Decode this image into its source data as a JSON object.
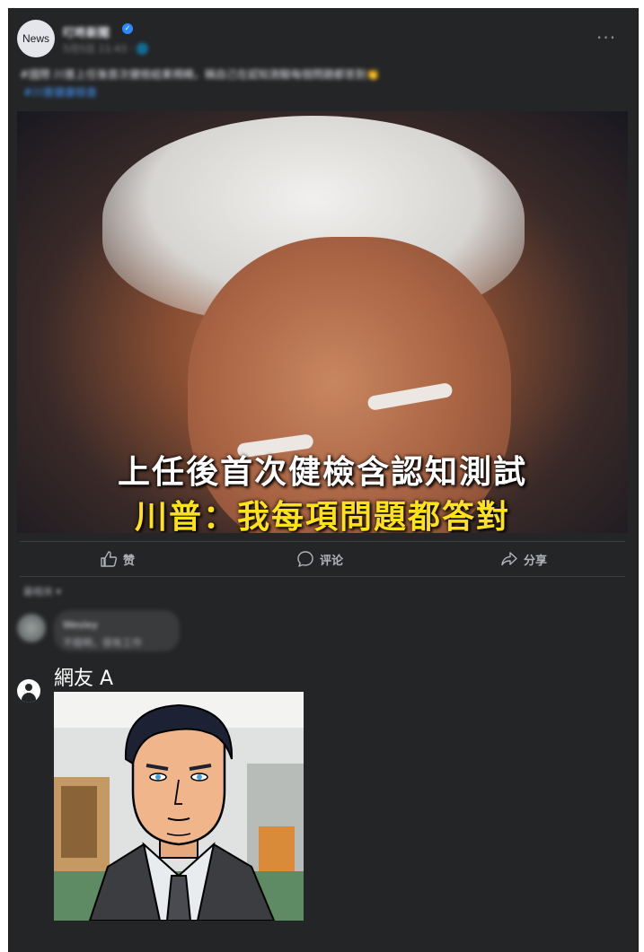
{
  "post": {
    "avatar_label": "News",
    "page_name": "叮咚新聞",
    "verified_glyph": "✓",
    "meta": "5月5日 11:43 · 🌐",
    "more_glyph": "···",
    "caption": "#國際 川普上任後首次健檢結果揭曉，稱自己在認知測驗每個問題都答對👏",
    "caption_link": "#川普健康檢查",
    "image": {
      "headline_line1": "上任後首次健檢含認知測試",
      "headline_line2": "川普：我每項問題都答對"
    }
  },
  "actions": {
    "like": "赞",
    "comment": "评论",
    "share": "分享"
  },
  "comments": {
    "sort_label": "最相关 ▾",
    "first": {
      "name": "Wesley",
      "text": "不錯啊，很有工作"
    },
    "reply": {
      "author": "網友 A"
    }
  },
  "colors": {
    "background": "#242526",
    "text_primary": "#e4e6eb",
    "text_secondary": "#b0b3b8",
    "link": "#4599ff",
    "headline_yellow": "#ffe21a"
  }
}
